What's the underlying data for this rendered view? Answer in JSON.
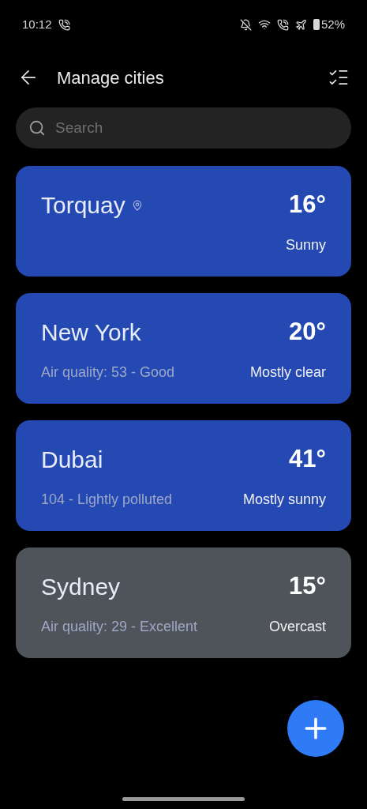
{
  "status_bar": {
    "time": "10:12",
    "battery": "52%"
  },
  "header": {
    "title": "Manage cities"
  },
  "search": {
    "placeholder": "Search"
  },
  "cities": [
    {
      "name": "Torquay",
      "current_location": true,
      "temperature": "16°",
      "condition": "Sunny",
      "color": "#2449b3"
    },
    {
      "name": "New York",
      "current_location": false,
      "air_quality": "Air quality: 53 - Good",
      "temperature": "20°",
      "condition": "Mostly clear",
      "color": "#2449b3"
    },
    {
      "name": "Dubai",
      "current_location": false,
      "air_quality": "104 - Lightly polluted",
      "temperature": "41°",
      "condition": "Mostly sunny",
      "color": "#2449b3"
    },
    {
      "name": "Sydney",
      "current_location": false,
      "air_quality": "Air quality: 29 - Excellent",
      "temperature": "15°",
      "condition": "Overcast",
      "color": "#4f545a"
    }
  ]
}
